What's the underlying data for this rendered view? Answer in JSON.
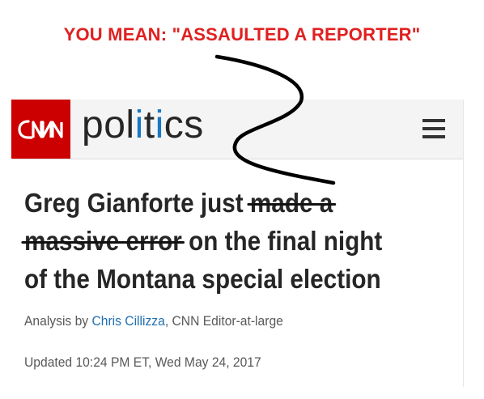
{
  "caption": "YOU MEAN: \"ASSAULTED A REPORTER\"",
  "header": {
    "logo_text": "CNN",
    "section_parts": [
      "pol",
      "i",
      "t",
      "i",
      "cs"
    ]
  },
  "article": {
    "headline": {
      "before": "Greg Gianforte just ",
      "struck_1": "made a",
      "struck_2": "massive error",
      "after": " on the final night of the Montana special election"
    },
    "byline": {
      "prefix": "Analysis by ",
      "author": "Chris Cillizza",
      "suffix": ", CNN Editor-at-large"
    },
    "updated": "Updated 10:24 PM ET, Wed May 24, 2017"
  },
  "colors": {
    "caption": "#e02020",
    "logo_bg": "#cc0000",
    "accent_i": "#1a78c2",
    "author_link": "#1f6fb2"
  },
  "icons": [
    "menu-icon",
    "squiggle-arrow"
  ]
}
